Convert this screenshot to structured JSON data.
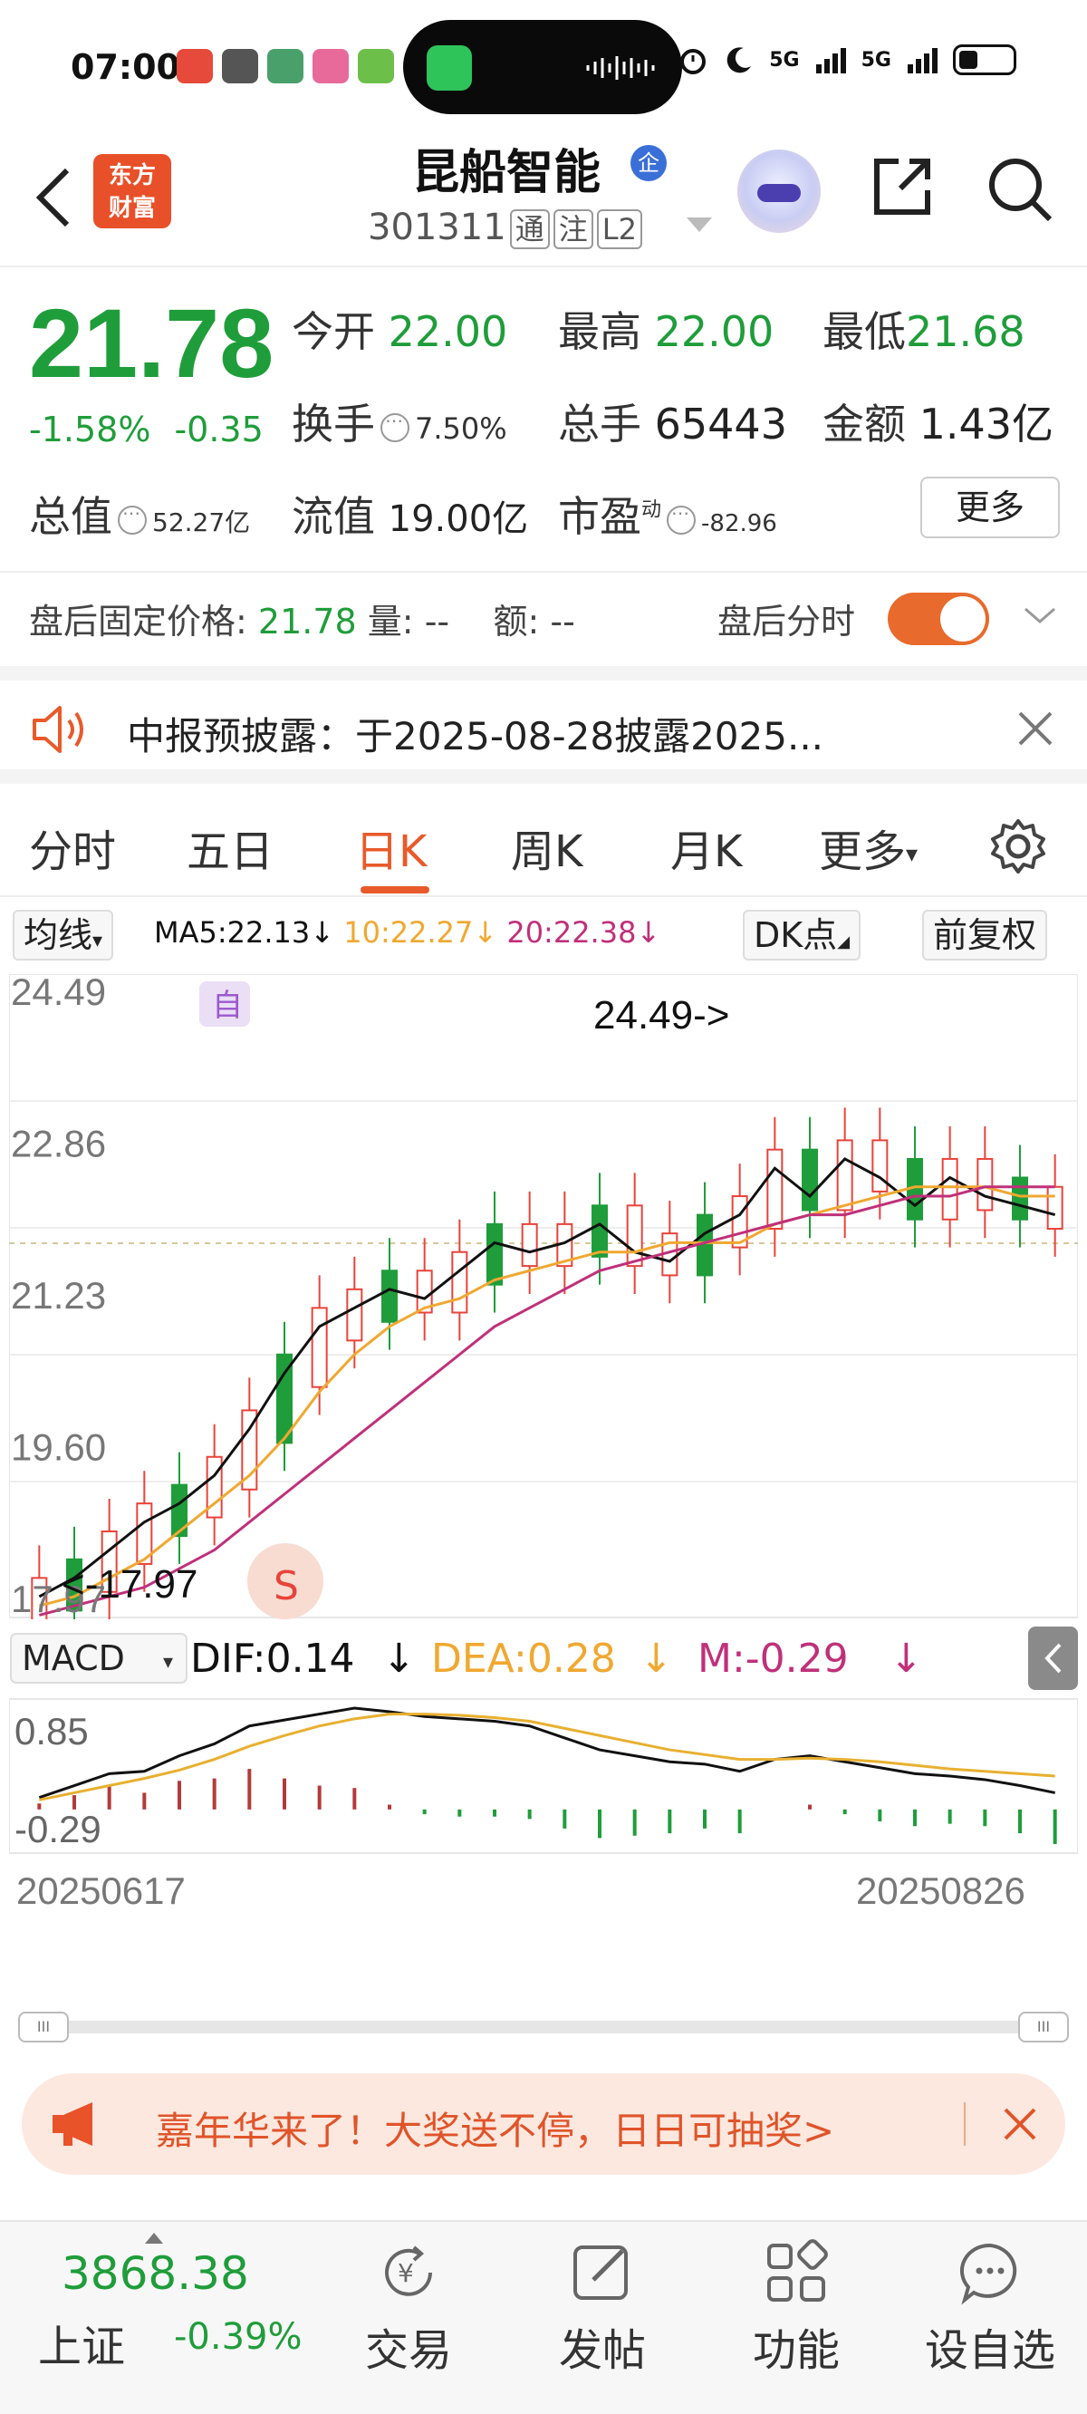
{
  "status_bar": {
    "time": "07:00",
    "network": "5G",
    "network2": "5G"
  },
  "header": {
    "logo_line1": "东方",
    "logo_line2": "财富",
    "stock_name": "昆船智能",
    "badge": "企",
    "stock_code": "301311",
    "tags": [
      "通",
      "注",
      "L2"
    ]
  },
  "quote": {
    "price": "21.78",
    "change_pct": "-1.58%",
    "change": "-0.35",
    "open_label": "今开",
    "open": "22.00",
    "high_label": "最高",
    "high": "22.00",
    "low_label": "最低",
    "low": "21.68",
    "turnover_label": "换手",
    "turnover": "7.50%",
    "volume_label": "总手",
    "volume": "65443",
    "amount_label": "金额",
    "amount": "1.43亿",
    "mktcap_label": "总值",
    "mktcap": "52.27亿",
    "float_label": "流值",
    "float": "19.00亿",
    "pe_label": "市盈",
    "pe_sup": "动",
    "pe": "-82.96",
    "more_button": "更多"
  },
  "after_hours": {
    "label": "盘后固定价格:",
    "price": "21.78",
    "vol_label": "量:",
    "vol": "--",
    "amt_label": "额:",
    "amt": "--",
    "toggle_label": "盘后分时",
    "toggle_on": true
  },
  "notice": {
    "text": "中报预披露：于2025-08-28披露2025..."
  },
  "tabs": [
    "分时",
    "五日",
    "日K",
    "周K",
    "月K",
    "更多"
  ],
  "active_tab": "日K",
  "ma_row": {
    "dropdown": "均线",
    "ma5": "MA5:22.13",
    "ma10": "10:22.27",
    "ma20": "20:22.38",
    "dk_button": "DK点",
    "adjust_button": "前复权"
  },
  "macd_row": {
    "dropdown": "MACD",
    "dif": "DIF:0.14",
    "dea": "DEA:0.28",
    "m": "M:-0.29"
  },
  "colors": {
    "up": "#e8433a",
    "down": "#1f9d3a",
    "accent": "#e85a2a",
    "ma5": "#111111",
    "ma10": "#f0a830",
    "ma20": "#c0307a"
  },
  "chart_data": [
    {
      "type": "candlestick",
      "axis_labels": [
        "24.49",
        "22.86",
        "21.23",
        "19.60",
        "17.97"
      ],
      "ylim": [
        17.97,
        24.49
      ],
      "high_annotation": "24.49->",
      "low_annotation": "<-17.97",
      "self_marker": "自",
      "date_start": "20250617",
      "date_end": "20250826",
      "series": [
        {
          "name": "MA5",
          "values": [
            18.0,
            18.2,
            18.5,
            18.8,
            19.0,
            19.3,
            19.8,
            20.4,
            20.9,
            21.1,
            21.3,
            21.2,
            21.5,
            21.8,
            21.7,
            21.8,
            22.0,
            21.7,
            21.6,
            21.9,
            22.1,
            22.6,
            22.3,
            22.7,
            22.5,
            22.2,
            22.5,
            22.3,
            22.2,
            22.1
          ]
        },
        {
          "name": "10",
          "values": [
            17.9,
            18.0,
            18.2,
            18.4,
            18.7,
            19.0,
            19.3,
            19.7,
            20.2,
            20.6,
            20.9,
            21.1,
            21.2,
            21.4,
            21.5,
            21.6,
            21.7,
            21.7,
            21.8,
            21.8,
            21.8,
            22.0,
            22.1,
            22.2,
            22.3,
            22.4,
            22.4,
            22.4,
            22.3,
            22.3
          ]
        },
        {
          "name": "20",
          "values": [
            17.8,
            17.9,
            18.0,
            18.1,
            18.3,
            18.5,
            18.8,
            19.1,
            19.4,
            19.7,
            20.0,
            20.3,
            20.6,
            20.9,
            21.1,
            21.3,
            21.5,
            21.6,
            21.7,
            21.8,
            21.9,
            22.0,
            22.1,
            22.1,
            22.2,
            22.3,
            22.3,
            22.4,
            22.4,
            22.4
          ]
        }
      ]
    },
    {
      "type": "bar",
      "axis_labels": [
        "0.85",
        "-0.29"
      ],
      "ylim": [
        -0.29,
        0.85
      ],
      "series": [
        {
          "name": "DIF",
          "values": [
            0.1,
            0.2,
            0.3,
            0.32,
            0.45,
            0.55,
            0.7,
            0.75,
            0.8,
            0.85,
            0.82,
            0.78,
            0.76,
            0.74,
            0.7,
            0.6,
            0.5,
            0.45,
            0.4,
            0.38,
            0.32,
            0.42,
            0.45,
            0.4,
            0.35,
            0.3,
            0.28,
            0.25,
            0.2,
            0.14
          ]
        },
        {
          "name": "DEA",
          "values": [
            0.08,
            0.14,
            0.2,
            0.26,
            0.33,
            0.42,
            0.53,
            0.62,
            0.7,
            0.76,
            0.8,
            0.8,
            0.79,
            0.77,
            0.74,
            0.68,
            0.62,
            0.56,
            0.5,
            0.46,
            0.42,
            0.42,
            0.43,
            0.42,
            0.4,
            0.37,
            0.34,
            0.32,
            0.3,
            0.28
          ]
        },
        {
          "name": "M",
          "values": [
            0.05,
            0.12,
            0.2,
            0.14,
            0.24,
            0.26,
            0.34,
            0.26,
            0.2,
            0.18,
            0.04,
            -0.04,
            -0.06,
            -0.06,
            -0.08,
            -0.16,
            -0.24,
            -0.22,
            -0.2,
            -0.16,
            -0.2,
            0.0,
            0.04,
            -0.04,
            -0.1,
            -0.14,
            -0.12,
            -0.14,
            -0.2,
            -0.29
          ]
        }
      ]
    }
  ],
  "progress_handles": [
    "III",
    "III"
  ],
  "promo": {
    "text": "嘉年华来了！大奖送不停，日日可抽奖>"
  },
  "bottom": {
    "index_value": "3868.38",
    "index_name": "上证",
    "index_change": "-0.39%",
    "nav": [
      "交易",
      "发帖",
      "功能",
      "设自选"
    ]
  }
}
